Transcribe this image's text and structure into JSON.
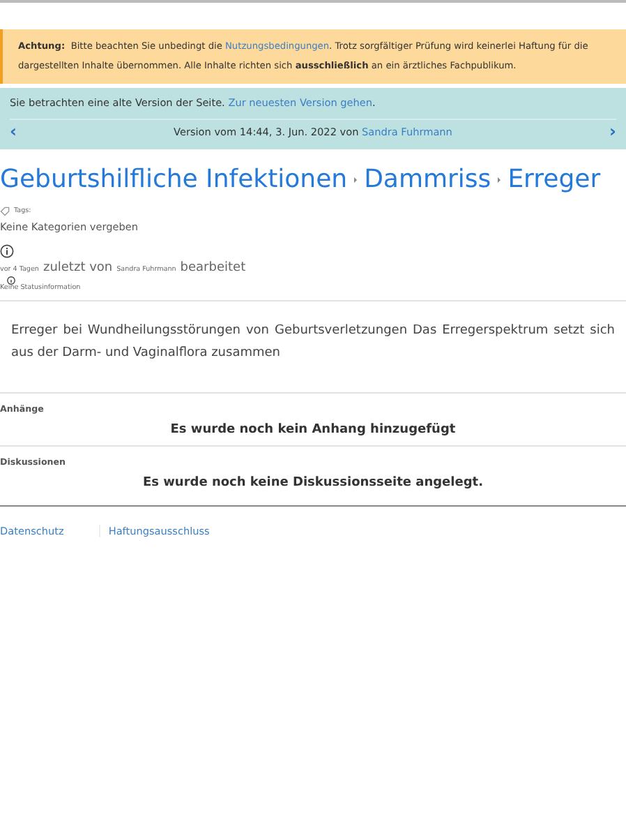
{
  "alert": {
    "label": "Achtung:",
    "parts": [
      {
        "kind": "text",
        "text": "Bitte beachten Sie unbedingt die "
      },
      {
        "kind": "link",
        "text": "Nutzungsbedingungen"
      },
      {
        "kind": "text",
        "text": ". Trotz sorgfältiger Prüfung wird keinerlei Haftung für die dargestellten Inhalte übernommen. Alle Inhalte richten sich **ausschließlich** an ein ärztliches Fachpublikum."
      }
    ]
  },
  "version_notice": {
    "text": "Sie betrachten eine alte Version der Seite.",
    "link": "Zur neuesten Version gehen",
    "link_suffix": ".",
    "prev": "‹",
    "label": "Version vom 14:44, 3. Jun. 2022 von",
    "author": "Sandra Fuhrmann",
    "next": "›"
  },
  "breadcrumbs": [
    {
      "label": "Geburtshilfliche Infektionen"
    },
    {
      "label": "Dammriss"
    },
    {
      "label": "Erreger"
    }
  ],
  "tags": {
    "label": "Tags:",
    "value": "Keine Kategorien vergeben"
  },
  "edited": {
    "time": "vor 4 Tagen",
    "by": "zuletzt von",
    "user": "Sandra Fuhrmann",
    "action": "bearbeitet"
  },
  "status": "Keine Statusinformation",
  "body": "Erreger bei Wundheilungsstörungen von Geburtsverletzungen Das Erregerspektrum setzt sich aus der Darm- und Vaginalflora zusammen",
  "sections": [
    {
      "title": "Anhänge",
      "message": "Es wurde noch kein Anhang hinzugefügt"
    },
    {
      "title": "Diskussionen",
      "message": "Es wurde noch keine Diskussionsseite angelegt."
    }
  ],
  "footer_links": [
    {
      "label": "Datenschutz"
    },
    {
      "label": "Haftungsausschluss"
    }
  ]
}
